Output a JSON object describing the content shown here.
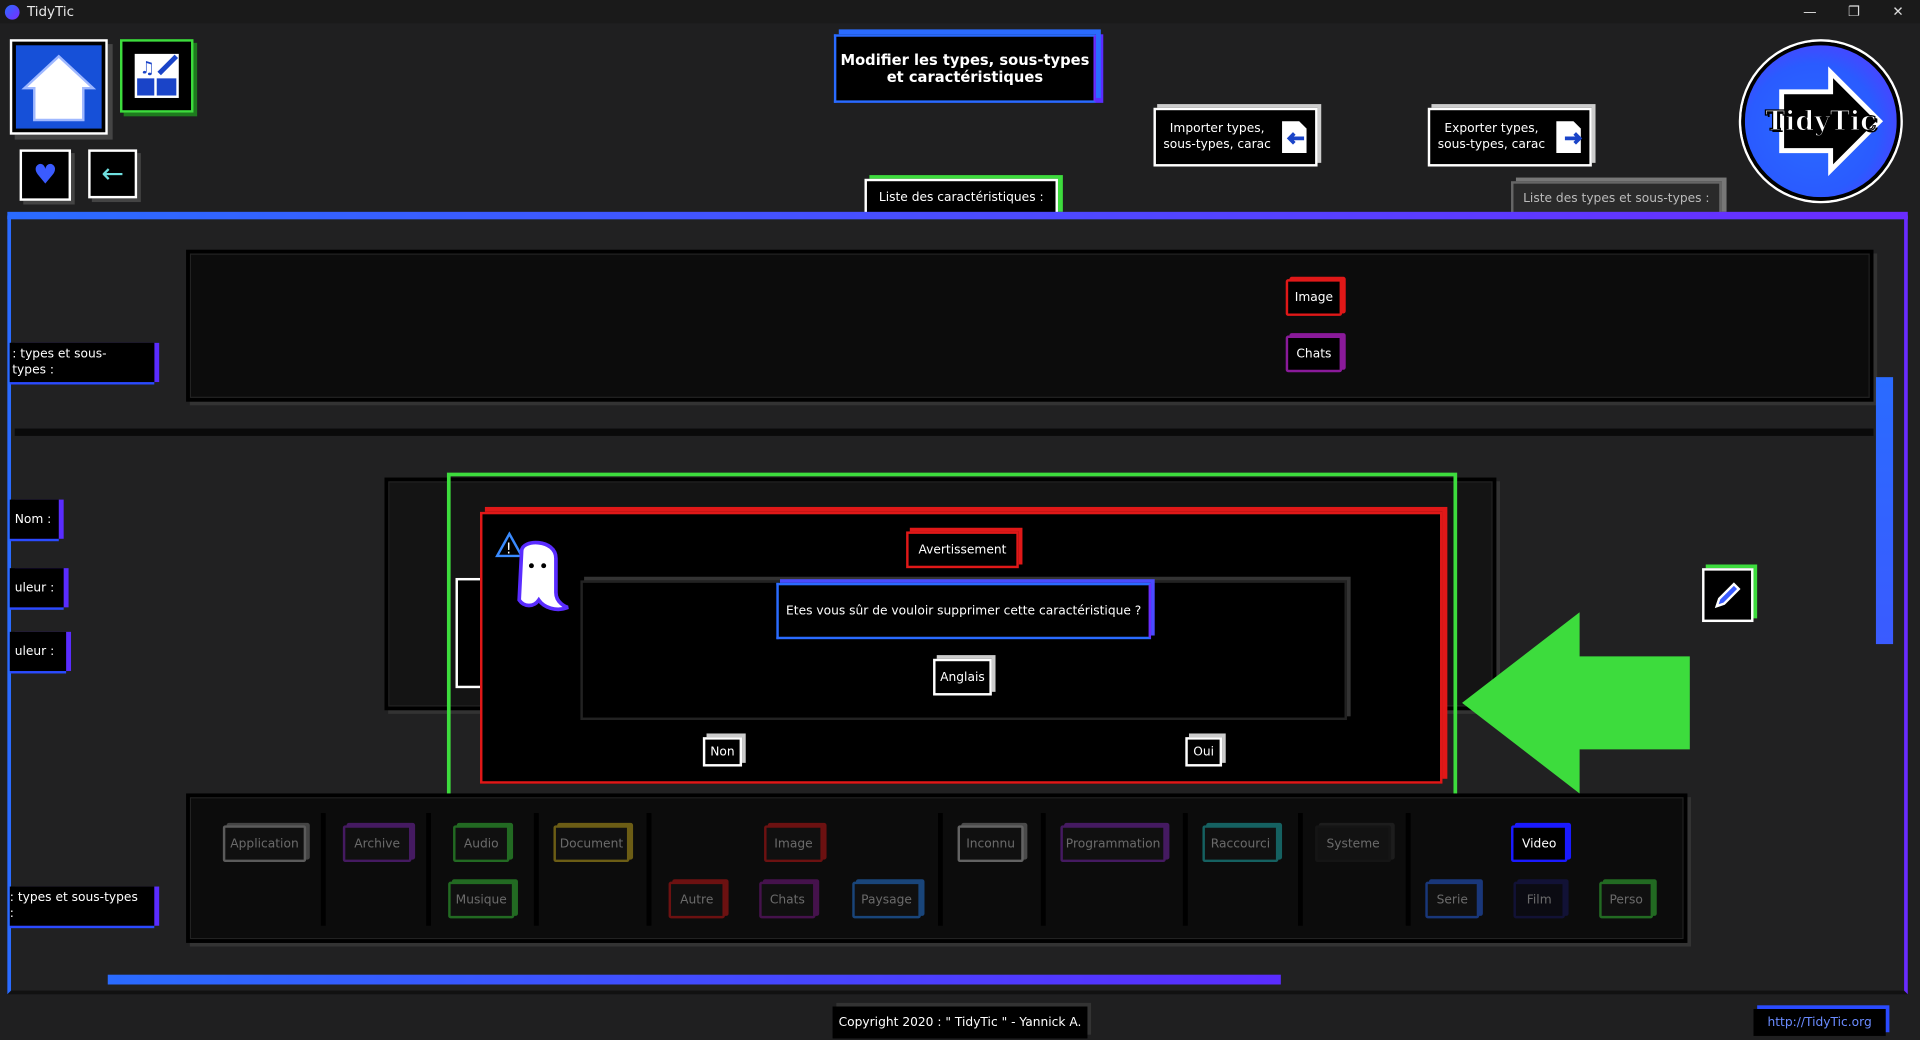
{
  "window": {
    "title": "TidyTic"
  },
  "header": {
    "title_line1": "Modifier les types, sous-types",
    "title_line2": "et caractéristiques",
    "import_line1": "Importer types,",
    "import_line2": "sous-types, carac",
    "export_line1": "Exporter types,",
    "export_line2": "sous-types, carac",
    "logo_text": "TidyTic"
  },
  "tabs": {
    "characteristics": "Liste des caractéristiques :",
    "types": "Liste des types et sous-types :"
  },
  "left_labels": {
    "types_top": ": types et sous-types :",
    "nom": "Nom :",
    "couleur1": "uleur :",
    "couleur2": "uleur :",
    "types_bottom": ": types et sous-types :"
  },
  "top_chips": [
    "Image",
    "Chats"
  ],
  "dialog": {
    "title": "Avertissement",
    "question": "Etes vous sûr de vouloir supprimer cette caractéristique ?",
    "item": "Anglais",
    "no": "Non",
    "yes": "Oui"
  },
  "bottom_types": {
    "application": "Application",
    "archive": "Archive",
    "audio": "Audio",
    "musique": "Musique",
    "document": "Document",
    "image": "Image",
    "autre": "Autre",
    "chats": "Chats",
    "paysage": "Paysage",
    "inconnu": "Inconnu",
    "programmation": "Programmation",
    "raccourci": "Raccourci",
    "systeme": "Systeme",
    "video": "Video",
    "serie": "Serie",
    "film": "Film",
    "perso": "Perso"
  },
  "footer": {
    "copyright": "Copyright 2020 : \" TidyTic \" - Yannick A.",
    "url": "http://TidyTic.org"
  },
  "colors": {
    "accent_blue": "#2a6bff",
    "accent_purple": "#6a2cff",
    "green": "#3ddc3d",
    "red": "#e01818"
  }
}
